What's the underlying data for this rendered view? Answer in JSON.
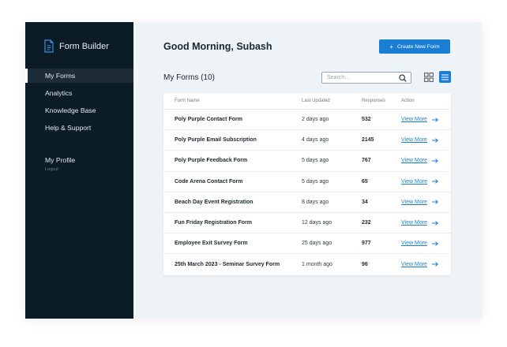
{
  "sidebar": {
    "brand": "Form Builder",
    "items": [
      {
        "label": "My Forms"
      },
      {
        "label": "Analytics"
      },
      {
        "label": "Knowledge Base"
      },
      {
        "label": "Help & Support"
      }
    ],
    "profile": {
      "name": "My Profile",
      "logout": "Logout"
    }
  },
  "header": {
    "greeting": "Good Morning, Subash",
    "create_button": "+ Create New Form",
    "create_label": "Create New Form"
  },
  "forms": {
    "heading": "My Forms (10)",
    "search_placeholder": "Search...",
    "columns": {
      "name": "Form Name",
      "updated": "Last Updated",
      "responses": "Responses",
      "action": "Action"
    },
    "action_label": "View More",
    "rows": [
      {
        "name": "Poly Purple Contact Form",
        "updated": "2 days ago",
        "responses": "532"
      },
      {
        "name": "Poly Purple Email Subscription",
        "updated": "4 days ago",
        "responses": "2145"
      },
      {
        "name": "Poly Purple Feedback Form",
        "updated": "5 days ago",
        "responses": "767"
      },
      {
        "name": "Code Arena Contact Form",
        "updated": "5 days ago",
        "responses": "65"
      },
      {
        "name": "Beach Day Event Registration",
        "updated": "8 days ago",
        "responses": "34"
      },
      {
        "name": "Fun Friday Registration Form",
        "updated": "12 days ago",
        "responses": "232"
      },
      {
        "name": "Employee Exit Survey Form",
        "updated": "25 days ago",
        "responses": "977"
      },
      {
        "name": "25th March 2023 - Seminar Survey Form",
        "updated": "1 month ago",
        "responses": "96"
      }
    ]
  },
  "colors": {
    "sidebar_bg": "#0c1c26",
    "accent": "#1a7fd4",
    "main_bg": "#eef3f7"
  },
  "icons": {
    "brand": "document-icon",
    "search": "search-icon",
    "grid": "grid-view-icon",
    "list": "list-view-icon",
    "arrow": "arrow-right-icon"
  }
}
